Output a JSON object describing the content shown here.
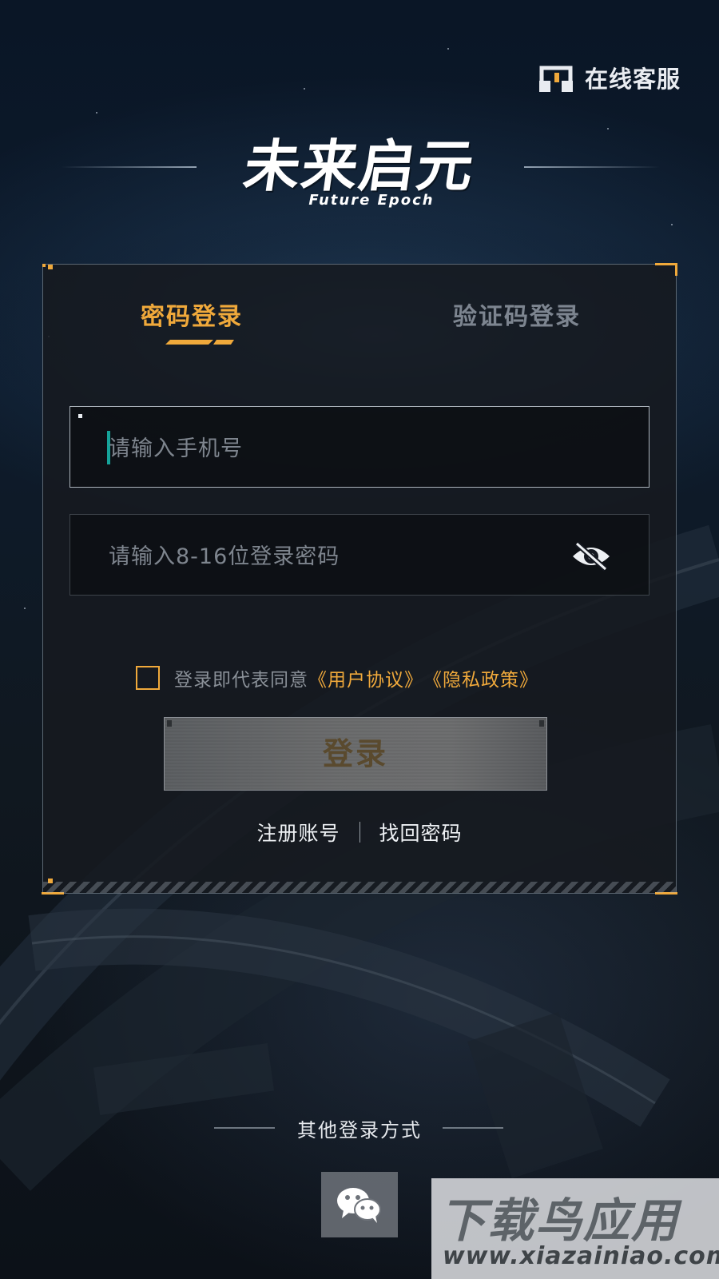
{
  "header": {
    "service_label": "在线客服",
    "service_icon": "headset-support-icon"
  },
  "logo": {
    "main": "未来启元",
    "sub": "Future Epoch"
  },
  "login": {
    "tabs": [
      {
        "label": "密码登录",
        "active": true
      },
      {
        "label": "验证码登录",
        "active": false
      }
    ],
    "phone_placeholder": "请输入手机号",
    "password_placeholder": "请输入8-16位登录密码",
    "password_visibility_icon": "eye-off-icon",
    "agreement": {
      "checked": false,
      "prefix": "登录即代表同意",
      "user_agreement": "《用户协议》",
      "privacy_policy": "《隐私政策》"
    },
    "login_button": "登录",
    "register_link": "注册账号",
    "recover_link": "找回密码"
  },
  "other_login": {
    "title": "其他登录方式",
    "methods": [
      {
        "name": "wechat",
        "icon": "wechat-icon"
      }
    ]
  },
  "watermark": {
    "main": "下载鸟应用",
    "sub": "www.xiazainiao.com"
  },
  "colors": {
    "accent": "#f0a93b",
    "caret": "#15a39a",
    "background": "#0d1b2c"
  }
}
